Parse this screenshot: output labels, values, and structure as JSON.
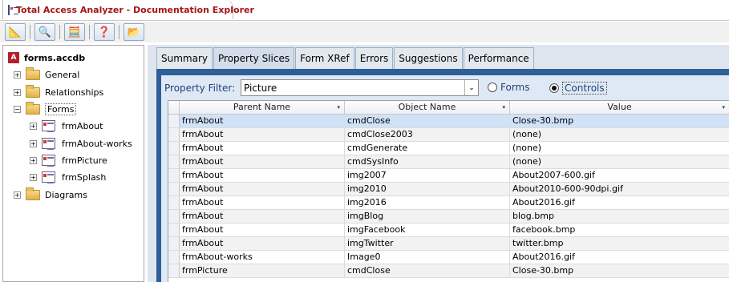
{
  "window": {
    "title": "Total Access Analyzer - Documentation Explorer",
    "icon": "form-window-icon"
  },
  "toolbar": {
    "buttons": [
      {
        "name": "analyze-icon",
        "glyph": "📐"
      },
      {
        "name": "find-icon",
        "glyph": "🔍"
      },
      {
        "name": "calculator-icon",
        "glyph": "🧮"
      },
      {
        "name": "help-icon",
        "glyph": "❓"
      },
      {
        "name": "open-folder-icon",
        "glyph": "📂"
      }
    ]
  },
  "tree": {
    "root": "forms.accdb",
    "root_icon": "A",
    "items": [
      {
        "label": "General",
        "expander": "+"
      },
      {
        "label": "Relationships",
        "expander": "+"
      },
      {
        "label": "Forms",
        "expander": "−"
      },
      {
        "label": "frmAbout",
        "expander": "+"
      },
      {
        "label": "frmAbout-works",
        "expander": "+"
      },
      {
        "label": "frmPicture",
        "expander": "+"
      },
      {
        "label": "frmSplash",
        "expander": "+"
      },
      {
        "label": "Diagrams",
        "expander": "+"
      }
    ]
  },
  "tabs": [
    "Summary",
    "Property Slices",
    "Form XRef",
    "Errors",
    "Suggestions",
    "Performance"
  ],
  "active_tab": "Property Slices",
  "filter": {
    "label": "Property Filter:",
    "value": "Picture",
    "dropdown_glyph": "⌄",
    "radio_forms": "Forms",
    "radio_controls": "Controls",
    "selected_radio": "Controls"
  },
  "grid": {
    "columns": [
      "Parent Name",
      "Object Name",
      "Value"
    ],
    "sort_glyph": "▾",
    "rows": [
      [
        "frmAbout",
        "cmdClose",
        "Close-30.bmp"
      ],
      [
        "frmAbout",
        "cmdClose2003",
        "(none)"
      ],
      [
        "frmAbout",
        "cmdGenerate",
        "(none)"
      ],
      [
        "frmAbout",
        "cmdSysInfo",
        "(none)"
      ],
      [
        "frmAbout",
        "img2007",
        "About2007-600.gif"
      ],
      [
        "frmAbout",
        "img2010",
        "About2010-600-90dpi.gif"
      ],
      [
        "frmAbout",
        "img2016",
        "About2016.gif"
      ],
      [
        "frmAbout",
        "imgBlog",
        "blog.bmp"
      ],
      [
        "frmAbout",
        "imgFacebook",
        "facebook.bmp"
      ],
      [
        "frmAbout",
        "imgTwitter",
        "twitter.bmp"
      ],
      [
        "frmAbout-works",
        "Image0",
        "About2016.gif"
      ],
      [
        "frmPicture",
        "cmdClose",
        "Close-30.bmp"
      ]
    ]
  }
}
